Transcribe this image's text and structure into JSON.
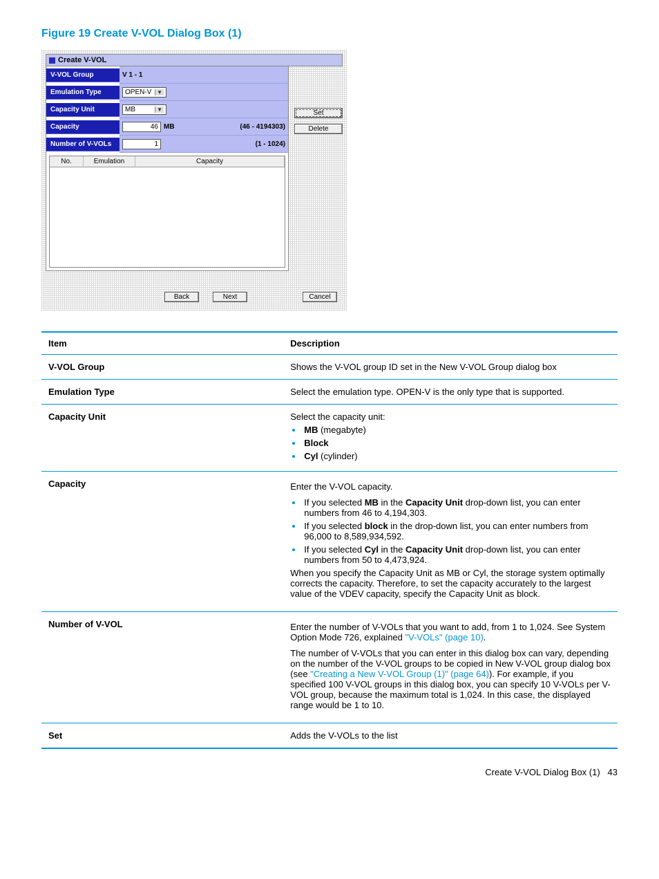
{
  "figure_title": "Figure 19 Create V-VOL Dialog Box (1)",
  "dialog": {
    "title": "Create V-VOL",
    "rows": {
      "group_lbl": "V-VOL Group",
      "group_val": "V 1 - 1",
      "emul_lbl": "Emulation Type",
      "emul_val": "OPEN-V",
      "capunit_lbl": "Capacity Unit",
      "capunit_val": "MB",
      "cap_lbl": "Capacity",
      "cap_val": "46",
      "cap_unit": "MB",
      "cap_hint": "(46 - 4194303)",
      "num_lbl": "Number of V-VOLs",
      "num_val": "1",
      "num_hint": "(1 - 1024)"
    },
    "list_headers": {
      "c1": "No.",
      "c2": "Emulation",
      "c3": "Capacity"
    },
    "side_buttons": {
      "set": "Set",
      "delete": "Delete"
    },
    "wizard_buttons": {
      "back": "Back",
      "next": "Next",
      "cancel": "Cancel"
    }
  },
  "table": {
    "head_item": "Item",
    "head_desc": "Description",
    "rows": {
      "r1_item": "V-VOL Group",
      "r1_desc": "Shows the V-VOL group ID set in the New V-VOL Group dialog box",
      "r2_item": "Emulation Type",
      "r2_desc": "Select the emulation type. OPEN-V is the only type that is supported.",
      "r3_item": "Capacity Unit",
      "r3_intro": "Select the capacity unit:",
      "r3_b1a": "MB",
      "r3_b1b": " (megabyte)",
      "r3_b2a": "Block",
      "r3_b3a": "Cyl",
      "r3_b3b": " (cylinder)",
      "r4_item": "Capacity",
      "r4_intro": "Enter the V-VOL capacity.",
      "r4_b1_p1": "If you selected ",
      "r4_b1_mb": "MB",
      "r4_b1_p2": " in the ",
      "r4_b1_cu": "Capacity Unit",
      "r4_b1_p3": " drop-down list, you can enter numbers from 46 to 4,194,303.",
      "r4_b2_p1": "If you selected ",
      "r4_b2_blk": "block",
      "r4_b2_p2": " in the drop-down list, you can enter numbers from 96,000 to 8,589,934,592.",
      "r4_b3_p1": "If you selected ",
      "r4_b3_cyl": "Cyl",
      "r4_b3_p2": " in the ",
      "r4_b3_cu": "Capacity Unit",
      "r4_b3_p3": " drop-down list, you can enter numbers from 50 to 4,473,924.",
      "r4_out": "When you specify the Capacity Unit as MB or Cyl, the storage system optimally corrects the capacity. Therefore, to set the capacity accurately to the largest value of the VDEV capacity, specify the Capacity Unit as block.",
      "r5_item": "Number of V-VOL",
      "r5_p1a": "Enter the number of V-VOLs that you want to add, from 1 to 1,024. See System Option Mode 726, explained ",
      "r5_p1link": "\"V-VOLs\" (page 10)",
      "r5_p1b": ".",
      "r5_p2a": "The number of V-VOLs that you can enter in this dialog box can vary, depending on the number of the V-VOL groups to be copied in New V-VOL group dialog box (see ",
      "r5_p2link": "\"Creating a New V-VOL Group (1)\" (page 64)",
      "r5_p2b": "). For example, if you specified 100 V-VOL groups in this dialog box, you can specify 10 V-VOLs per V-VOL group, because the maximum total is 1,024. In this case, the displayed range would be 1 to 10.",
      "r6_item": "Set",
      "r6_desc": "Adds the V-VOLs to the list"
    }
  },
  "footer": {
    "text": "Create V-VOL Dialog Box (1)",
    "page": "43"
  }
}
